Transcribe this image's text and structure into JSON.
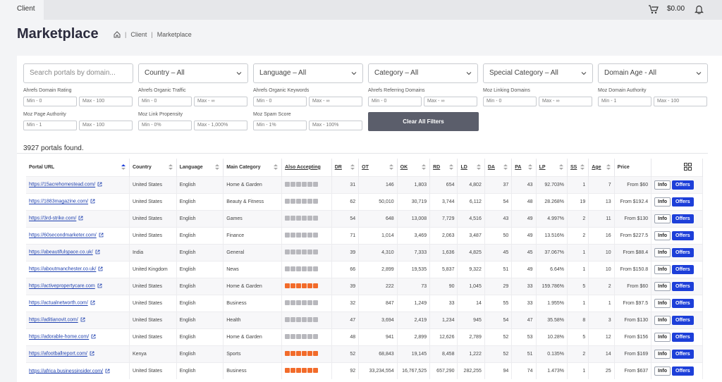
{
  "topbar": {
    "tab": "Client",
    "balance": "$0.00"
  },
  "page": {
    "title": "Marketplace"
  },
  "breadcrumb": [
    "Client",
    "Marketplace"
  ],
  "filters": {
    "search_placeholder": "Search portals by domain...",
    "dropdowns": [
      "Country – All",
      "Language – All",
      "Category – All",
      "Special Category – All",
      "Domain Age - All"
    ],
    "ranges": [
      {
        "label": "Ahrefs Domain Rating",
        "min": "Min - 0",
        "max": "Max - 100"
      },
      {
        "label": "Ahrefs Organic Traffic",
        "min": "Min - 0",
        "max": "Max - ∞"
      },
      {
        "label": "Ahrefs Organic Keywords",
        "min": "Min - 0",
        "max": "Max - ∞"
      },
      {
        "label": "Ahrefs Referring Domains",
        "min": "Min - 0",
        "max": "Max - ∞"
      },
      {
        "label": "Moz Linking Domains",
        "min": "Min - 0",
        "max": "Max - ∞"
      },
      {
        "label": "Moz Domain Authority",
        "min": "Min - 1",
        "max": "Max - 100"
      },
      {
        "label": "Moz Page Authority",
        "min": "Min - 1",
        "max": "Max - 100"
      },
      {
        "label": "Moz Link Propensity",
        "min": "Min - 0%",
        "max": "Max - 1,000%"
      },
      {
        "label": "Moz Spam Score",
        "min": "Min - 1%",
        "max": "Max - 100%"
      }
    ],
    "clear_label": "Clear All Filters"
  },
  "results_count": "3927 portals found.",
  "table": {
    "headers": [
      "Portal URL",
      "Country",
      "Language",
      "Main Category",
      "Also Accepting",
      "DR",
      "OT",
      "OK",
      "RD",
      "LD",
      "DA",
      "PA",
      "LP",
      "SS",
      "Age",
      "Price"
    ],
    "info_label": "Info",
    "offers_label": "Offers",
    "rows": [
      [
        "https://15acrehomestead.com/",
        "United States",
        "English",
        "Home & Garden",
        "31",
        "146",
        "1,803",
        "654",
        "4,802",
        "37",
        "43",
        "92.703%",
        "1",
        "7",
        "From $60"
      ],
      [
        "https://1883magazine.com/",
        "United States",
        "English",
        "Beauty & Fitness",
        "62",
        "50,010",
        "30,719",
        "3,744",
        "6,112",
        "54",
        "48",
        "28.268%",
        "19",
        "13",
        "From $192.4"
      ],
      [
        "https://3rd-strike.com/",
        "United States",
        "English",
        "Games",
        "54",
        "648",
        "13,008",
        "7,729",
        "4,516",
        "43",
        "49",
        "4.997%",
        "2",
        "11",
        "From $130"
      ],
      [
        "https://60secondmarketer.com/",
        "United States",
        "English",
        "Finance",
        "71",
        "1,014",
        "3,469",
        "2,063",
        "3,487",
        "50",
        "49",
        "13.516%",
        "2",
        "16",
        "From $227.5"
      ],
      [
        "https://abeautifulspace.co.uk/",
        "India",
        "English",
        "General",
        "39",
        "4,310",
        "7,333",
        "1,636",
        "4,825",
        "45",
        "45",
        "37.067%",
        "1",
        "10",
        "From $88.4"
      ],
      [
        "https://aboutmanchester.co.uk/",
        "United Kingdom",
        "English",
        "News",
        "66",
        "2,899",
        "19,535",
        "5,837",
        "9,322",
        "51",
        "49",
        "6.64%",
        "1",
        "10",
        "From $150.8"
      ],
      [
        "https://activepropertycare.com",
        "United States",
        "English",
        "Home & Garden",
        "39",
        "222",
        "73",
        "90",
        "1,045",
        "29",
        "33",
        "159.786%",
        "5",
        "2",
        "From $60"
      ],
      [
        "https://actualnetworth.com/",
        "United States",
        "English",
        "Business",
        "32",
        "847",
        "1,249",
        "33",
        "14",
        "55",
        "33",
        "1.955%",
        "1",
        "1",
        "From $97.5"
      ],
      [
        "https://aditianovit.com/",
        "United States",
        "English",
        "Health",
        "47",
        "3,694",
        "2,419",
        "1,234",
        "945",
        "54",
        "47",
        "35.58%",
        "8",
        "3",
        "From $130"
      ],
      [
        "https://adorable-home.com/",
        "United States",
        "English",
        "Home & Garden",
        "48",
        "941",
        "2,899",
        "12,626",
        "2,789",
        "52",
        "53",
        "10.28%",
        "5",
        "12",
        "From $156"
      ],
      [
        "https://afootballreport.com/",
        "Kenya",
        "English",
        "Sports",
        "52",
        "68,843",
        "19,145",
        "8,458",
        "1,222",
        "52",
        "51",
        "0.135%",
        "2",
        "14",
        "From $169"
      ],
      [
        "https://africa.businessinsider.com/",
        "United States",
        "English",
        "Business",
        "92",
        "33,234,554",
        "16,767,525",
        "657,290",
        "282,255",
        "94",
        "74",
        "1.473%",
        "1",
        "25",
        "From $637"
      ]
    ],
    "hot_rows": [
      6,
      10,
      11
    ]
  }
}
